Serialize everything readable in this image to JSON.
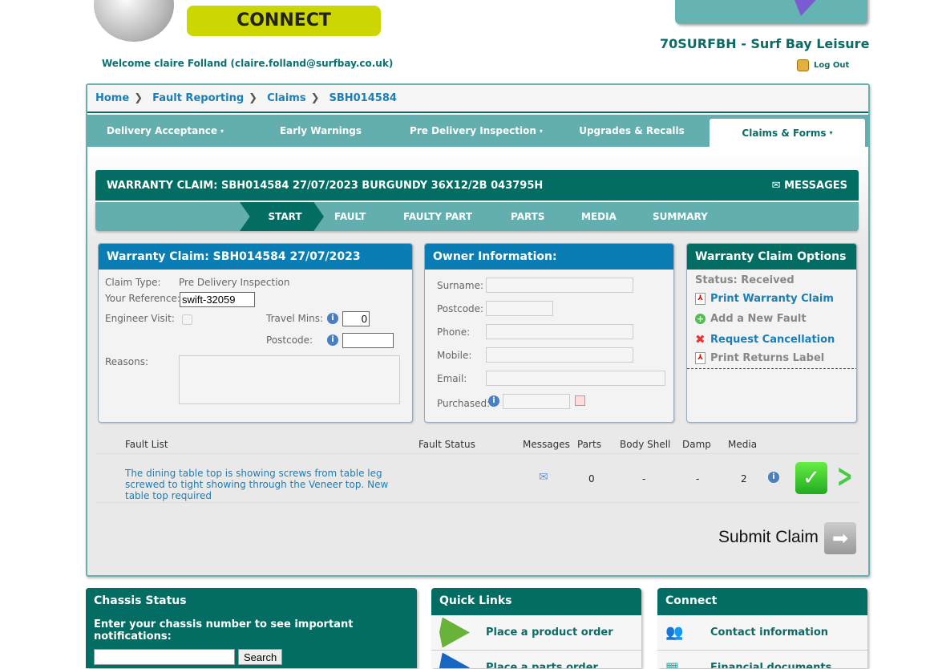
{
  "header": {
    "brand": "CONNECT",
    "welcome": "Welcome claire Folland (claire.folland@surfbay.co.uk)",
    "dealer": "70SURFBH - Surf Bay Leisure",
    "logout": "Log Out"
  },
  "breadcrumb": [
    "Home",
    "Fault Reporting",
    "Claims",
    "SBH014584"
  ],
  "nav": [
    {
      "label": "Delivery Acceptance",
      "caret": "▾"
    },
    {
      "label": "Early Warnings"
    },
    {
      "label": "Pre Delivery Inspection",
      "caret": "▾"
    },
    {
      "label": "Upgrades & Recalls"
    },
    {
      "label": "Claims & Forms",
      "caret": "▾",
      "active": true
    }
  ],
  "claim": {
    "title": "WARRANTY CLAIM: SBH014584 27/07/2023 BURGUNDY 36X12/2B 043795H",
    "messages": "MESSAGES",
    "steps": [
      "START",
      "FAULT",
      "FAULTY PART",
      "PARTS",
      "MEDIA",
      "SUMMARY"
    ]
  },
  "claim_panel": {
    "title": "Warranty Claim: SBH014584 27/07/2023",
    "claim_type_label": "Claim Type:",
    "claim_type": "Pre Delivery Inspection",
    "reference_label": "Your Reference:",
    "reference": "swift-32059",
    "engineer_label": "Engineer Visit:",
    "engineer_checked": false,
    "travel_label": "Travel Mins:",
    "travel": "0",
    "postcode_label": "Postcode:",
    "postcode": "",
    "reasons_label": "Reasons:",
    "reasons": ""
  },
  "owner_panel": {
    "title": "Owner Information:",
    "fields": [
      "Surname:",
      "Postcode:",
      "Phone:",
      "Mobile:",
      "Email:",
      "Purchased:"
    ]
  },
  "options_panel": {
    "title": "Warranty Claim Options",
    "status": "Status: Received",
    "items": [
      "Print Warranty Claim",
      "Add a New Fault",
      "Request Cancellation",
      "Print Returns Label"
    ]
  },
  "fault_list": {
    "headers": [
      "Fault List",
      "Fault Status",
      "Messages",
      "Parts",
      "Body Shell",
      "Damp",
      "Media"
    ],
    "rows": [
      {
        "description": "The dining table top is showing screws from table leg screwed to tight showing through the Veneer top. New table top required",
        "status": "",
        "parts": "0",
        "body_shell": "-",
        "damp": "-",
        "media": "2"
      }
    ]
  },
  "submit": "Submit Claim",
  "chassis": {
    "title": "Chassis Status",
    "prompt": "Enter your chassis number to see important notifications:",
    "search": "Search"
  },
  "quick_links": {
    "title": "Quick Links",
    "items": [
      "Place a product order",
      "Place a parts order"
    ]
  },
  "connect": {
    "title": "Connect",
    "items": [
      "Contact information",
      "Financial documents"
    ]
  }
}
